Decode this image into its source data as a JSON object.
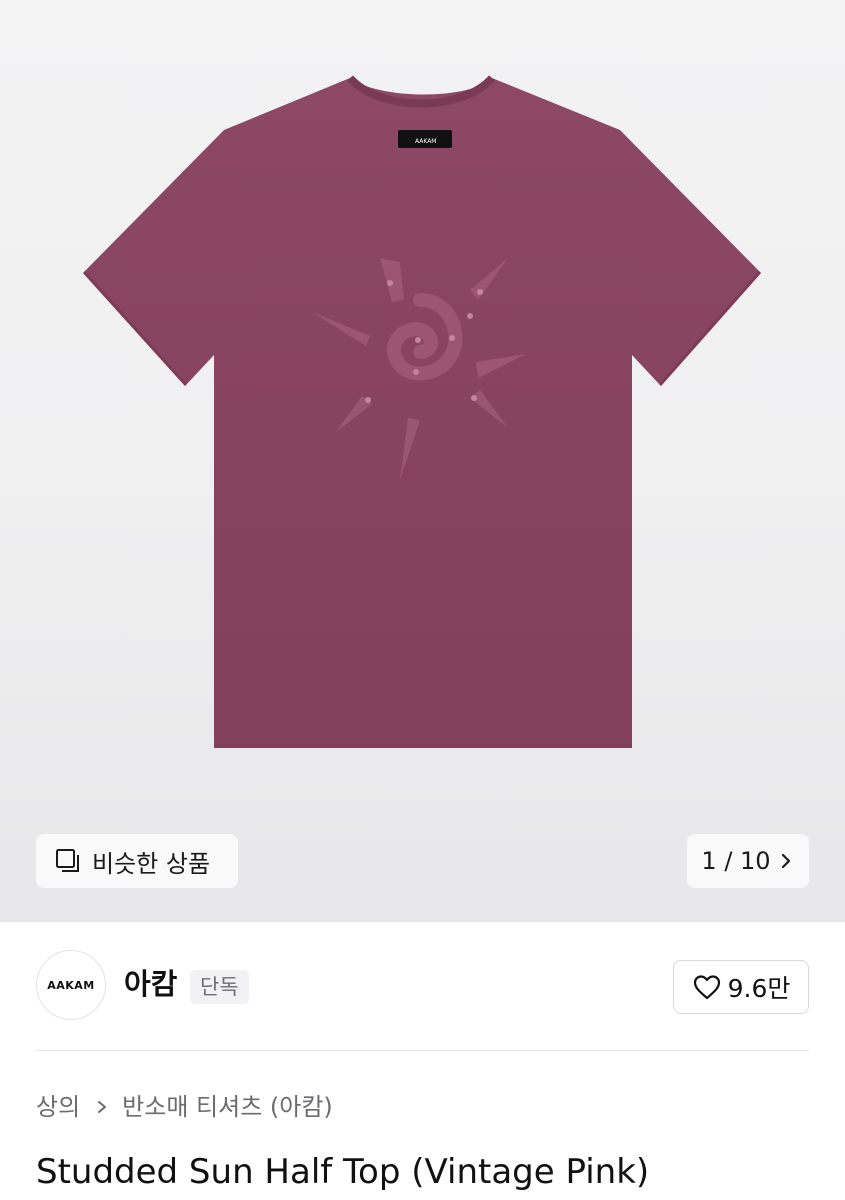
{
  "gallery": {
    "similar_label": "비슷한 상품",
    "pager_text": "1 / 10",
    "shirt_color": "#8a4662",
    "shirt_label": "AAKAM"
  },
  "brand": {
    "logo_text": "AAKAM",
    "name": "아캄",
    "badge": "단독",
    "likes": "9.6만"
  },
  "breadcrumb": {
    "category": "상의",
    "subcategory": "반소매 티셔츠 (아캄)"
  },
  "product": {
    "title": "Studded Sun Half Top (Vintage Pink)"
  }
}
